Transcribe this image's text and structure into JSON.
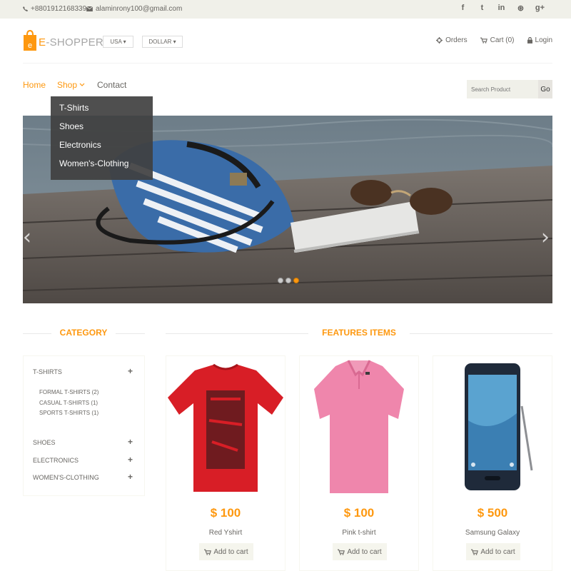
{
  "topbar": {
    "phone": "+8801912168339",
    "email": "alaminrony100@gmail.com",
    "social": [
      {
        "icon": "facebook-icon",
        "glyph": "f"
      },
      {
        "icon": "twitter-icon",
        "glyph": "t"
      },
      {
        "icon": "linkedin-icon",
        "glyph": "in"
      },
      {
        "icon": "dribbble-icon",
        "glyph": "⊛"
      },
      {
        "icon": "google-plus-icon",
        "glyph": "g+"
      }
    ]
  },
  "header": {
    "logo_letter": "e",
    "logo_text_first": "E",
    "logo_text_rest": "-SHOPPER",
    "country_select": "USA ▾",
    "currency_select": "DOLLAR ▾",
    "links": {
      "orders": "Orders",
      "cart": "Cart (0)",
      "login": "Login"
    }
  },
  "nav": {
    "home": "Home",
    "shop": "Shop",
    "contact": "Contact",
    "shop_dropdown": [
      "T-Shirts",
      "Shoes",
      "Electronics",
      "Women's-Clothing"
    ],
    "search_placeholder": "Search Product",
    "search_button": "Go"
  },
  "slider": {
    "active_slide": 3,
    "slide_count": 3
  },
  "sidebar": {
    "title": "CATEGORY",
    "categories": [
      {
        "label": "T-SHIRTS",
        "subs": [
          "FORMAL T-SHIRTS (2)",
          "CASUAL T-SHIRTS (1)",
          "SPORTS T-SHIRTS (1)"
        ]
      },
      {
        "label": "SHOES"
      },
      {
        "label": "ELECTRONICS"
      },
      {
        "label": "WOMEN'S-CLOTHING"
      }
    ]
  },
  "features": {
    "title": "FEATURES ITEMS",
    "add_to_cart": "Add to cart",
    "products": [
      {
        "name": "Red Yshirt",
        "price": "$ 100"
      },
      {
        "name": "Pink t-shirt",
        "price": "$ 100"
      },
      {
        "name": "Samsung Galaxy",
        "price": "$ 500"
      }
    ]
  },
  "colors": {
    "accent": "#fe980f",
    "topbar_bg": "#f0f0e9",
    "text": "#696763"
  }
}
